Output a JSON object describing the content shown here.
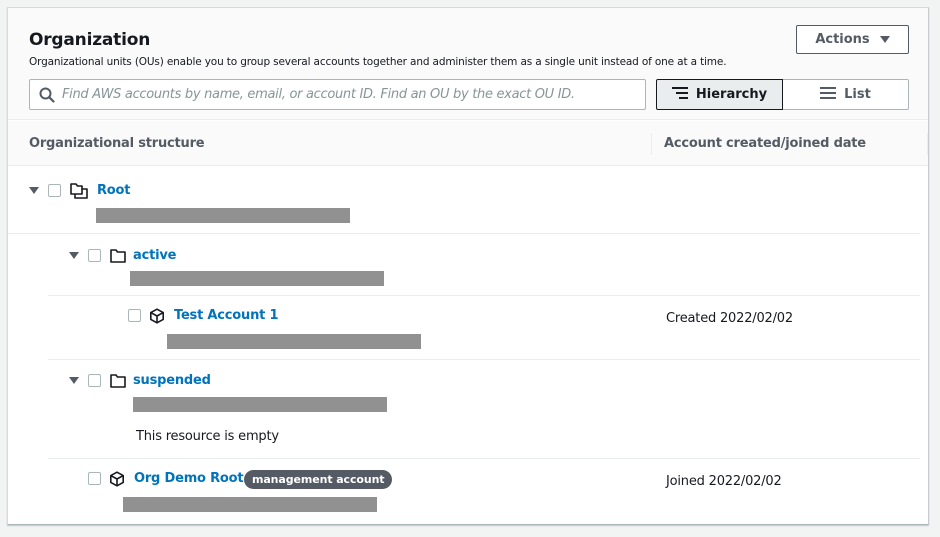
{
  "header": {
    "title": "Organization",
    "description": "Organizational units (OUs) enable you to group several accounts together and administer them as a single unit instead of one at a time.",
    "actions_label": "Actions",
    "search": {
      "placeholder": "Find AWS accounts by name, email, or account ID. Find an OU by the exact OU ID.",
      "value": ""
    },
    "view_toggle": {
      "options": [
        {
          "label": "Hierarchy",
          "icon": "hierarchy-icon",
          "selected": true
        },
        {
          "label": "List",
          "icon": "list-icon",
          "selected": false
        }
      ]
    }
  },
  "table": {
    "columns": [
      "Organizational structure",
      "Account created/joined date"
    ],
    "rows": [
      {
        "type": "root",
        "name": "Root",
        "expanded": true,
        "icon": "root-icon",
        "date": "",
        "badge": ""
      },
      {
        "type": "ou",
        "name": "active",
        "expanded": true,
        "icon": "folder-icon",
        "date": "",
        "badge": ""
      },
      {
        "type": "account",
        "name": "Test Account 1",
        "icon": "account-cube-icon",
        "date": "Created 2022/02/02",
        "badge": ""
      },
      {
        "type": "ou",
        "name": "suspended",
        "expanded": true,
        "icon": "folder-icon",
        "date": "",
        "badge": "",
        "empty_text": "This resource is empty"
      },
      {
        "type": "account",
        "name": "Org Demo Root",
        "icon": "account-cube-icon",
        "date": "Joined 2022/02/02",
        "badge": "management account"
      }
    ]
  },
  "colors": {
    "link": "#0073bb",
    "badge_bg": "#545b64",
    "redaction": "#919191"
  }
}
